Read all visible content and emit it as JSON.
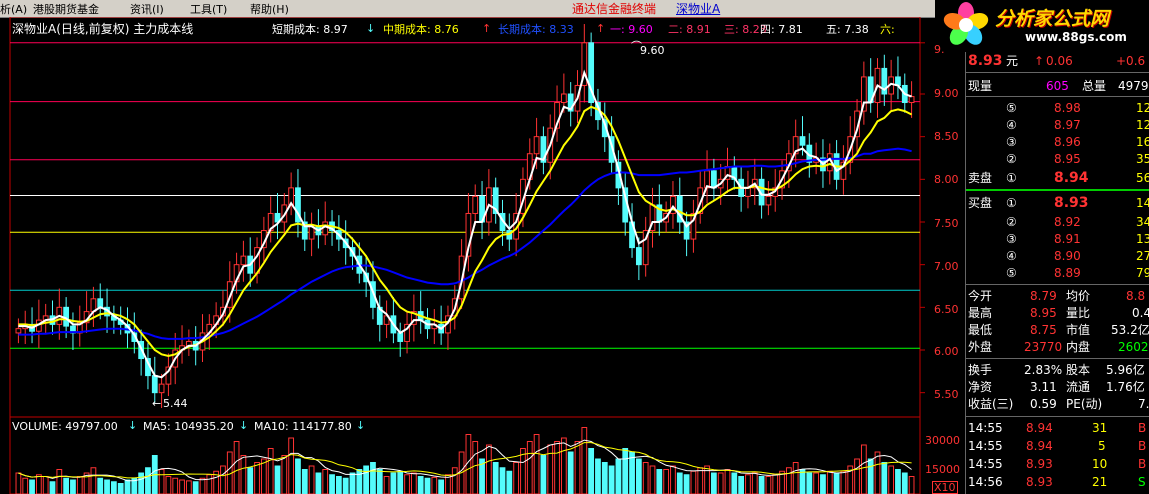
{
  "menu": {
    "items": [
      "析(A)",
      "港股期货基金",
      "资讯(I)",
      "工具(T)",
      "帮助(H)"
    ],
    "app_title": "通达信金融终端",
    "stock_link": "深物业A"
  },
  "logo": {
    "brand": "分析家公式网",
    "url": "www.88gs.com"
  },
  "header": {
    "stock_title": "深物业A(日线,前复权) 主力成本线",
    "short_cost_label": "短期成本: 8.97",
    "mid_cost_label": "中期成本: 8.76",
    "long_cost_label": "长期成本: 8.33",
    "levels": [
      "一: 9.60",
      "二: 8.91",
      "三: 8.23",
      "四: 7.81",
      "五: 7.38",
      "六:"
    ]
  },
  "annotations": {
    "high": "9.60",
    "low": "5.44"
  },
  "volume_header": {
    "volume": "VOLUME: 49797.00",
    "ma5": "MA5: 104935.20",
    "ma10": "MA10: 114177.80"
  },
  "price_axis": [
    "9.",
    "9.00",
    "8.50",
    "8.00",
    "7.50",
    "7.00",
    "6.50",
    "6.00",
    "5.50"
  ],
  "volume_axis": [
    "30000",
    "15000",
    "X10"
  ],
  "quote": {
    "price": "8.93",
    "price_unit": "元",
    "change": "0.06",
    "change_pct": "+0.6",
    "xianliang_label": "现量",
    "xianliang": "605",
    "zongliang_label": "总量",
    "zongliang": "4979",
    "sell_label": "卖盘",
    "buy_label": "买盘",
    "sells": [
      {
        "idx": "⑤",
        "price": "8.98",
        "vol": "12"
      },
      {
        "idx": "④",
        "price": "8.97",
        "vol": "12"
      },
      {
        "idx": "③",
        "price": "8.96",
        "vol": "16"
      },
      {
        "idx": "②",
        "price": "8.95",
        "vol": "35"
      },
      {
        "idx": "①",
        "price": "8.94",
        "vol": "56"
      }
    ],
    "buys": [
      {
        "idx": "①",
        "price": "8.93",
        "vol": "14"
      },
      {
        "idx": "②",
        "price": "8.92",
        "vol": "34"
      },
      {
        "idx": "③",
        "price": "8.91",
        "vol": "13"
      },
      {
        "idx": "④",
        "price": "8.90",
        "vol": "27"
      },
      {
        "idx": "⑤",
        "price": "8.89",
        "vol": "79"
      }
    ],
    "stats": [
      {
        "l1": "今开",
        "v1": "8.79",
        "l2": "均价",
        "v2": "8.8"
      },
      {
        "l1": "最高",
        "v1": "8.95",
        "l2": "量比",
        "v2": "0.4"
      },
      {
        "l1": "最低",
        "v1": "8.75",
        "l2": "市值",
        "v2": "53.2亿"
      },
      {
        "l1": "外盘",
        "v1": "23770",
        "l2": "内盘",
        "v2": "2602"
      }
    ],
    "stats2": [
      {
        "l1": "换手",
        "v1": "2.83%",
        "l2": "股本",
        "v2": "5.96亿"
      },
      {
        "l1": "净资",
        "v1": "3.11",
        "l2": "流通",
        "v2": "1.76亿"
      },
      {
        "l1": "收益(三)",
        "v1": "0.59",
        "l2": "PE(动)",
        "v2": "7."
      }
    ],
    "ticks": [
      {
        "time": "14:55",
        "price": "8.94",
        "vol": "31",
        "side": "B"
      },
      {
        "time": "14:55",
        "price": "8.94",
        "vol": "5",
        "side": "B"
      },
      {
        "time": "14:55",
        "price": "8.93",
        "vol": "10",
        "side": "B"
      },
      {
        "time": "14:56",
        "price": "8.93",
        "vol": "21",
        "side": "S"
      }
    ]
  },
  "colors": {
    "up": "#ff3333",
    "down": "#54fcfc",
    "short_ma": "#ffffff",
    "mid_ma": "#ffff00",
    "long_ma": "#0000ff",
    "level_red": "#ff0055",
    "level_white": "#ffffff",
    "level_yellow": "#ffff00",
    "level_green": "#00ff00"
  },
  "chart_data": {
    "type": "candlestick",
    "price_range": [
      5.3,
      9.7
    ],
    "levels": [
      9.6,
      8.91,
      8.23,
      7.81,
      7.38,
      6.7,
      6.02
    ],
    "close": [
      6.25,
      6.3,
      6.22,
      6.35,
      6.4,
      6.3,
      6.5,
      6.28,
      6.2,
      6.32,
      6.45,
      6.6,
      6.5,
      6.4,
      6.35,
      6.3,
      6.2,
      6.1,
      5.9,
      5.7,
      5.5,
      5.6,
      5.8,
      6.0,
      6.05,
      6.1,
      6.0,
      6.2,
      6.3,
      6.4,
      6.5,
      6.8,
      7.0,
      7.1,
      6.9,
      7.2,
      7.4,
      7.6,
      7.5,
      7.7,
      7.9,
      7.5,
      7.3,
      7.45,
      7.35,
      7.5,
      7.4,
      7.3,
      7.2,
      7.1,
      6.9,
      6.8,
      6.5,
      6.3,
      6.4,
      6.2,
      6.1,
      6.3,
      6.45,
      6.35,
      6.25,
      6.3,
      6.2,
      6.4,
      6.6,
      7.1,
      7.6,
      7.8,
      7.5,
      7.9,
      7.6,
      7.4,
      7.3,
      7.6,
      8.0,
      8.3,
      8.5,
      8.2,
      8.6,
      8.9,
      9.0,
      8.8,
      9.1,
      9.6,
      8.9,
      8.7,
      8.5,
      8.2,
      7.9,
      7.5,
      7.2,
      7.0,
      7.4,
      7.7,
      7.5,
      7.6,
      7.8,
      7.5,
      7.3,
      7.6,
      7.9,
      8.1,
      7.9,
      8.0,
      8.15,
      8.0,
      7.8,
      7.9,
      8.0,
      7.7,
      7.8,
      7.9,
      8.1,
      8.3,
      8.5,
      8.4,
      8.2,
      8.25,
      8.1,
      8.3,
      8.0,
      8.2,
      8.5,
      8.8,
      9.2,
      8.9,
      9.3,
      9.0,
      9.2,
      9.1,
      8.9,
      8.97
    ],
    "short_cost": [
      6.28,
      6.28,
      6.26,
      6.3,
      6.35,
      6.36,
      6.4,
      6.37,
      6.3,
      6.3,
      6.35,
      6.45,
      6.5,
      6.47,
      6.4,
      6.35,
      6.28,
      6.18,
      6.02,
      5.85,
      5.7,
      5.68,
      5.75,
      5.9,
      6.0,
      6.05,
      6.05,
      6.12,
      6.2,
      6.3,
      6.42,
      6.62,
      6.82,
      6.98,
      7.0,
      7.1,
      7.25,
      7.42,
      7.48,
      7.58,
      7.72,
      7.6,
      7.45,
      7.45,
      7.4,
      7.45,
      7.42,
      7.35,
      7.26,
      7.15,
      7.0,
      6.88,
      6.68,
      6.48,
      6.42,
      6.3,
      6.2,
      6.25,
      6.35,
      6.35,
      6.3,
      6.3,
      6.25,
      6.32,
      6.48,
      6.8,
      7.2,
      7.5,
      7.5,
      7.7,
      7.65,
      7.52,
      7.42,
      7.5,
      7.75,
      8.0,
      8.25,
      8.23,
      8.4,
      8.65,
      8.85,
      8.82,
      8.95,
      9.25,
      9.05,
      8.85,
      8.65,
      8.4,
      8.12,
      7.8,
      7.5,
      7.25,
      7.3,
      7.5,
      7.5,
      7.55,
      7.68,
      7.58,
      7.45,
      7.52,
      7.72,
      7.92,
      7.9,
      7.95,
      8.05,
      8.02,
      7.9,
      7.9,
      7.95,
      7.82,
      7.82,
      7.86,
      8.0,
      8.16,
      8.33,
      8.36,
      8.28,
      8.26,
      8.18,
      8.24,
      8.1,
      8.15,
      8.35,
      8.58,
      8.9,
      8.9,
      9.1,
      9.05,
      9.12,
      9.1,
      9.0,
      8.97
    ],
    "mid_cost": [
      6.3,
      6.3,
      6.29,
      6.3,
      6.32,
      6.33,
      6.36,
      6.36,
      6.34,
      6.33,
      6.34,
      6.38,
      6.42,
      6.43,
      6.42,
      6.4,
      6.36,
      6.3,
      6.2,
      6.1,
      6.0,
      5.95,
      5.93,
      5.95,
      6.0,
      6.04,
      6.06,
      6.1,
      6.15,
      6.22,
      6.3,
      6.42,
      6.56,
      6.7,
      6.8,
      6.9,
      7.02,
      7.15,
      7.25,
      7.35,
      7.46,
      7.48,
      7.46,
      7.47,
      7.45,
      7.46,
      7.45,
      7.43,
      7.38,
      7.3,
      7.2,
      7.1,
      6.96,
      6.82,
      6.72,
      6.6,
      6.5,
      6.45,
      6.43,
      6.4,
      6.37,
      6.35,
      6.32,
      6.33,
      6.38,
      6.52,
      6.72,
      6.92,
      7.05,
      7.2,
      7.3,
      7.35,
      7.36,
      7.42,
      7.55,
      7.7,
      7.86,
      7.98,
      8.1,
      8.25,
      8.4,
      8.5,
      8.62,
      8.8,
      8.85,
      8.82,
      8.75,
      8.62,
      8.45,
      8.25,
      8.05,
      7.85,
      7.75,
      7.7,
      7.65,
      7.63,
      7.65,
      7.62,
      7.58,
      7.58,
      7.62,
      7.7,
      7.75,
      7.8,
      7.86,
      7.9,
      7.9,
      7.9,
      7.92,
      7.9,
      7.88,
      7.88,
      7.92,
      7.98,
      8.06,
      8.12,
      8.15,
      8.16,
      8.15,
      8.18,
      8.15,
      8.15,
      8.22,
      8.3,
      8.45,
      8.55,
      8.68,
      8.72,
      8.8,
      8.82,
      8.8,
      8.76
    ],
    "long_cost": [
      6.18,
      6.18,
      6.18,
      6.19,
      6.19,
      6.2,
      6.21,
      6.21,
      6.21,
      6.21,
      6.22,
      6.23,
      6.24,
      6.25,
      6.25,
      6.25,
      6.24,
      6.23,
      6.21,
      6.19,
      6.16,
      6.14,
      6.13,
      6.13,
      6.13,
      6.14,
      6.14,
      6.15,
      6.16,
      6.18,
      6.2,
      6.23,
      6.27,
      6.31,
      6.35,
      6.39,
      6.44,
      6.49,
      6.54,
      6.59,
      6.65,
      6.7,
      6.75,
      6.8,
      6.84,
      6.88,
      6.92,
      6.95,
      6.97,
      6.98,
      6.99,
      6.99,
      6.98,
      6.96,
      6.94,
      6.91,
      6.88,
      6.85,
      6.83,
      6.81,
      6.79,
      6.78,
      6.77,
      6.77,
      6.78,
      6.81,
      6.85,
      6.9,
      6.94,
      6.99,
      7.03,
      7.07,
      7.1,
      7.14,
      7.2,
      7.26,
      7.33,
      7.4,
      7.47,
      7.55,
      7.63,
      7.7,
      7.78,
      7.87,
      7.94,
      8.0,
      8.04,
      8.07,
      8.08,
      8.08,
      8.07,
      8.05,
      8.05,
      8.05,
      8.05,
      8.06,
      8.07,
      8.08,
      8.08,
      8.09,
      8.1,
      8.11,
      8.12,
      8.13,
      8.14,
      8.15,
      8.15,
      8.15,
      8.16,
      8.16,
      8.15,
      8.15,
      8.16,
      8.17,
      8.19,
      8.21,
      8.22,
      8.23,
      8.23,
      8.24,
      8.24,
      8.24,
      8.25,
      8.27,
      8.3,
      8.3,
      8.33,
      8.34,
      8.35,
      8.36,
      8.35,
      8.33
    ],
    "volume": [
      12000,
      9000,
      8000,
      11000,
      10000,
      7000,
      14000,
      9000,
      8000,
      10000,
      12000,
      15000,
      9000,
      8000,
      7000,
      6000,
      8000,
      9000,
      12000,
      15000,
      22000,
      14000,
      10000,
      9000,
      8000,
      7500,
      7000,
      9000,
      11000,
      13000,
      16000,
      24000,
      30000,
      22000,
      15000,
      18000,
      20000,
      26000,
      16000,
      22000,
      32000,
      20000,
      14000,
      16000,
      12000,
      14000,
      11000,
      10000,
      9000,
      12000,
      14000,
      16000,
      18000,
      14000,
      10000,
      12000,
      13000,
      11000,
      12000,
      10000,
      9000,
      9500,
      8000,
      11000,
      15000,
      24000,
      34000,
      30000,
      20000,
      28000,
      18000,
      15000,
      13000,
      18000,
      26000,
      30000,
      34000,
      22000,
      28000,
      30000,
      32000,
      24000,
      30000,
      38000,
      26000,
      20000,
      18000,
      16000,
      20000,
      26000,
      24000,
      20000,
      18000,
      16000,
      14000,
      14000,
      16000,
      12000,
      11000,
      13000,
      15000,
      16000,
      12000,
      12000,
      14000,
      12000,
      10000,
      11000,
      12000,
      10000,
      10000,
      11000,
      13000,
      15000,
      18000,
      14000,
      12000,
      12000,
      11000,
      13000,
      12000,
      13000,
      16000,
      20000,
      28000,
      20000,
      24000,
      18000,
      16000,
      14000,
      12000,
      10000
    ],
    "ma5_volume_label": "104935.20",
    "ma10_volume_label": "114177.80"
  }
}
